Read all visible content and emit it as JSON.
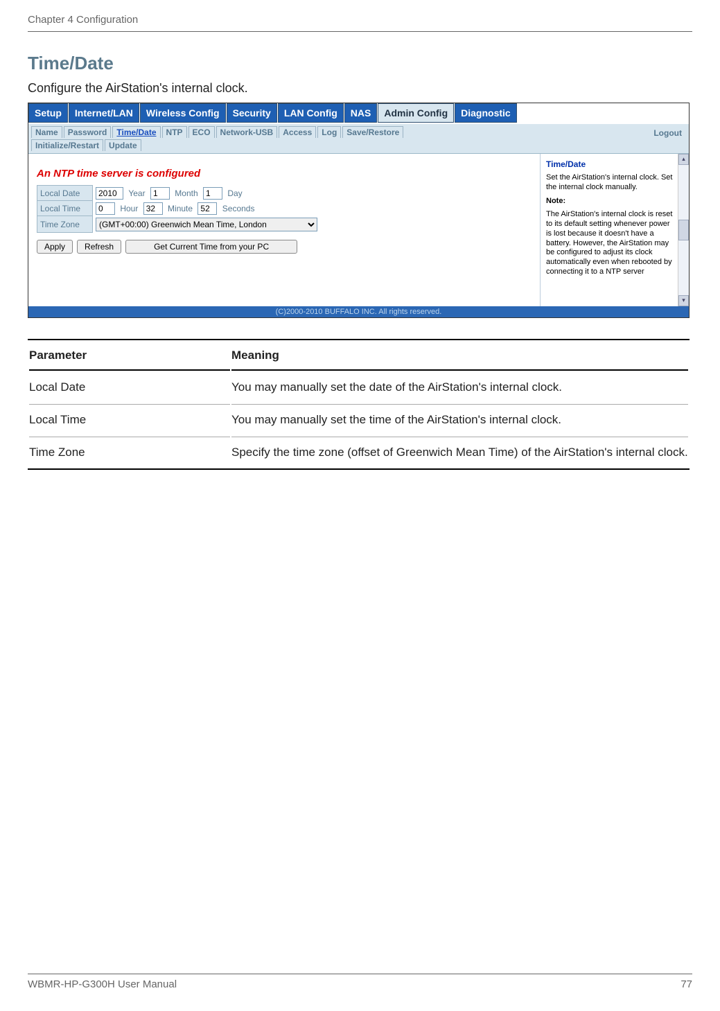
{
  "chapter": "Chapter 4  Configuration",
  "section_title": "Time/Date",
  "section_desc": "Configure the AirStation's internal clock.",
  "main_tabs": [
    "Setup",
    "Internet/LAN",
    "Wireless Config",
    "Security",
    "LAN Config",
    "NAS",
    "Admin Config",
    "Diagnostic"
  ],
  "sub_tabs_row1": [
    "Name",
    "Password",
    "Time/Date",
    "NTP",
    "ECO",
    "Network-USB",
    "Access",
    "Log",
    "Save/Restore"
  ],
  "sub_tabs_row2": [
    "Initialize/Restart",
    "Update"
  ],
  "logout": "Logout",
  "ntp_notice": "An NTP time server is configured",
  "form": {
    "local_date_label": "Local Date",
    "year_value": "2010",
    "year_unit": "Year",
    "month_value": "1",
    "month_unit": "Month",
    "day_value": "1",
    "day_unit": "Day",
    "local_time_label": "Local Time",
    "hour_value": "0",
    "hour_unit": "Hour",
    "minute_value": "32",
    "minute_unit": "Minute",
    "second_value": "52",
    "second_unit": "Seconds",
    "tz_label": "Time Zone",
    "tz_value": "(GMT+00:00) Greenwich Mean Time, London"
  },
  "buttons": {
    "apply": "Apply",
    "refresh": "Refresh",
    "get_pc": "Get Current Time from your PC"
  },
  "help": {
    "heading": "Time/Date",
    "line1": "Set the AirStation's internal clock. Set the internal clock manually.",
    "note_label": "Note:",
    "note_body": "The AirStation's internal clock is reset to its default setting whenever power is lost because it doesn't have a battery. However, the AirStation may be configured to adjust its clock automatically even when rebooted by connecting it to a NTP server"
  },
  "copyright": "(C)2000-2010 BUFFALO INC. All rights reserved.",
  "table": {
    "h1": "Parameter",
    "h2": "Meaning",
    "rows": [
      {
        "p": "Local Date",
        "m": "You may manually set the date of the AirStation's internal clock."
      },
      {
        "p": "Local Time",
        "m": "You may manually set the time of the AirStation's internal clock."
      },
      {
        "p": "Time Zone",
        "m": "Specify the time zone (offset of Greenwich Mean Time) of the AirStation's internal clock."
      }
    ]
  },
  "footer": {
    "manual": "WBMR-HP-G300H User Manual",
    "page": "77"
  }
}
